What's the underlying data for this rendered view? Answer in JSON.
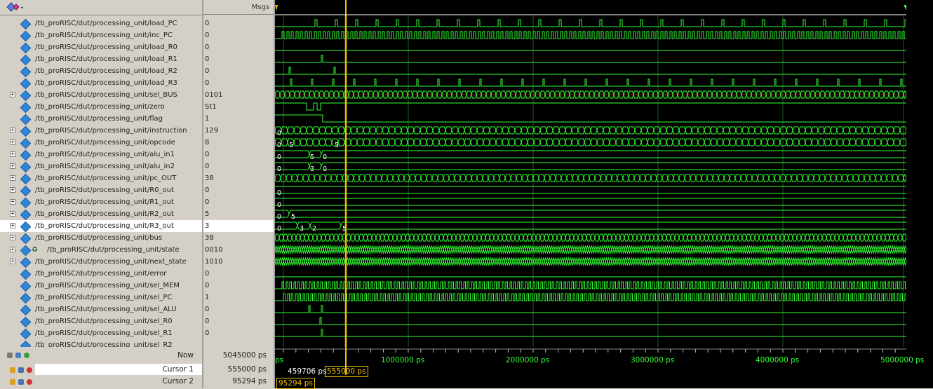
{
  "header": {
    "msgs_label": "Msgs"
  },
  "signals": [
    {
      "name": "/tb_proRISC/dut/processing_unit/load_PC",
      "value": "0",
      "expandable": false,
      "icon": "signal-icon"
    },
    {
      "name": "/tb_proRISC/dut/processing_unit/inc_PC",
      "value": "0",
      "expandable": false,
      "icon": "signal-icon"
    },
    {
      "name": "/tb_proRISC/dut/processing_unit/load_R0",
      "value": "0",
      "expandable": false,
      "icon": "signal-icon"
    },
    {
      "name": "/tb_proRISC/dut/processing_unit/load_R1",
      "value": "0",
      "expandable": false,
      "icon": "signal-icon"
    },
    {
      "name": "/tb_proRISC/dut/processing_unit/load_R2",
      "value": "0",
      "expandable": false,
      "icon": "signal-icon"
    },
    {
      "name": "/tb_proRISC/dut/processing_unit/load_R3",
      "value": "0",
      "expandable": false,
      "icon": "signal-icon"
    },
    {
      "name": "/tb_proRISC/dut/processing_unit/sel_BUS",
      "value": "0101",
      "expandable": true,
      "icon": "signal-icon"
    },
    {
      "name": "/tb_proRISC/dut/processing_unit/zero",
      "value": "St1",
      "expandable": false,
      "icon": "signal-icon"
    },
    {
      "name": "/tb_proRISC/dut/processing_unit/flag",
      "value": "1",
      "expandable": false,
      "icon": "signal-icon"
    },
    {
      "name": "/tb_proRISC/dut/processing_unit/instruction",
      "value": "129",
      "expandable": true,
      "icon": "signal-icon"
    },
    {
      "name": "/tb_proRISC/dut/processing_unit/opcode",
      "value": "8",
      "expandable": true,
      "icon": "signal-icon"
    },
    {
      "name": "/tb_proRISC/dut/processing_unit/alu_in1",
      "value": "0",
      "expandable": true,
      "icon": "signal-icon"
    },
    {
      "name": "/tb_proRISC/dut/processing_unit/alu_in2",
      "value": "0",
      "expandable": true,
      "icon": "signal-icon"
    },
    {
      "name": "/tb_proRISC/dut/processing_unit/pc_OUT",
      "value": "38",
      "expandable": true,
      "icon": "signal-icon"
    },
    {
      "name": "/tb_proRISC/dut/processing_unit/R0_out",
      "value": "0",
      "expandable": true,
      "icon": "signal-icon"
    },
    {
      "name": "/tb_proRISC/dut/processing_unit/R1_out",
      "value": "0",
      "expandable": true,
      "icon": "signal-icon"
    },
    {
      "name": "/tb_proRISC/dut/processing_unit/R2_out",
      "value": "5",
      "expandable": true,
      "icon": "signal-icon"
    },
    {
      "name": "/tb_proRISC/dut/processing_unit/R3_out",
      "value": "3",
      "expandable": true,
      "icon": "signal-icon",
      "selected": true
    },
    {
      "name": "/tb_proRISC/dut/processing_unit/bus",
      "value": "38",
      "expandable": true,
      "icon": "signal-icon"
    },
    {
      "name": "/tb_proRISC/dut/processing_unit/state",
      "value": "0010",
      "expandable": true,
      "icon": "state-machine-icon"
    },
    {
      "name": "/tb_proRISC/dut/processing_unit/next_state",
      "value": "1010",
      "expandable": true,
      "icon": "signal-icon"
    },
    {
      "name": "/tb_proRISC/dut/processing_unit/error",
      "value": "0",
      "expandable": false,
      "icon": "signal-icon"
    },
    {
      "name": "/tb_proRISC/dut/processing_unit/sel_MEM",
      "value": "0",
      "expandable": false,
      "icon": "signal-icon"
    },
    {
      "name": "/tb_proRISC/dut/processing_unit/sel_PC",
      "value": "1",
      "expandable": false,
      "icon": "signal-icon"
    },
    {
      "name": "/tb_proRISC/dut/processing_unit/sel_ALU",
      "value": "0",
      "expandable": false,
      "icon": "signal-icon"
    },
    {
      "name": "/tb_proRISC/dut/processing_unit/sel_R0",
      "value": "0",
      "expandable": false,
      "icon": "signal-icon"
    },
    {
      "name": "/tb_proRISC/dut/processing_unit/sel_R1",
      "value": "0",
      "expandable": false,
      "icon": "signal-icon"
    },
    {
      "name": "/tb_proRISC/dut/processing_unit/sel_R2",
      "value": "",
      "expandable": false,
      "icon": "signal-icon"
    }
  ],
  "wave_labels": {
    "instruction": "0",
    "opcode": [
      "0",
      "5",
      "5"
    ],
    "alu_in1": [
      "0",
      "5",
      "0"
    ],
    "alu_in2": [
      "0",
      "3",
      "0"
    ],
    "R0_out": "0",
    "R1_out": "0",
    "R2_out": [
      "0",
      "5"
    ],
    "R3_out": [
      "0",
      "3",
      "2",
      "5"
    ]
  },
  "status": {
    "now_label": "Now",
    "now_value": "5045000 ps",
    "cursor1_label": "Cursor 1",
    "cursor1_value": "555000 ps",
    "cursor2_label": "Cursor 2",
    "cursor2_value": "95294 ps"
  },
  "timeline": {
    "unit_fragment": "ps",
    "ticks": [
      "1000000 ps",
      "2000000 ps",
      "3000000 ps",
      "4000000 ps",
      "5000000 ps"
    ],
    "cursor_delta": "459706 ps",
    "cursor1_marker": "555000 ps",
    "cursor2_marker": "95294 ps"
  },
  "colors": {
    "wave": "#33ff33",
    "cursor": "#f0c000",
    "grid": "#1e5a1e",
    "bus_red": "#ff3030"
  }
}
